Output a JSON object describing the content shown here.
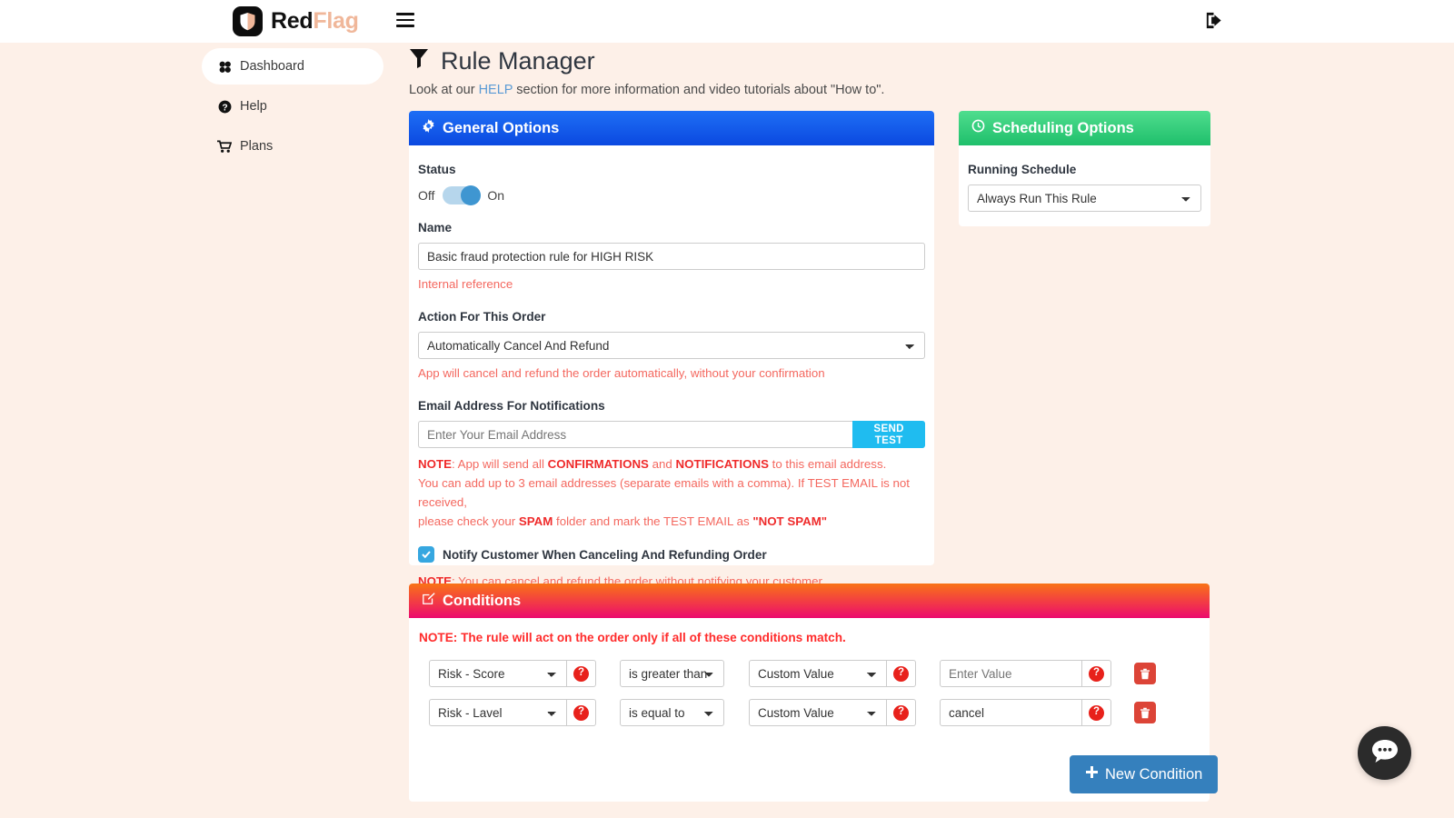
{
  "topbar": {
    "brand_red": "Red",
    "brand_flag": "Flag",
    "menu_icon": "hamburger-menu-icon",
    "logout_icon": "sign-out-icon"
  },
  "sidebar": {
    "items": [
      {
        "label": "Dashboard",
        "icon": "dashboard-icon",
        "active": true
      },
      {
        "label": "Help",
        "icon": "question-circle-icon",
        "active": false
      },
      {
        "label": "Plans",
        "icon": "shopping-cart-icon",
        "active": false
      }
    ]
  },
  "page": {
    "title": "Rule Manager",
    "title_icon": "filter-icon",
    "sub_before": "Look at our ",
    "sub_link": "HELP",
    "sub_after": " section for more information and video tutorials about \"How to\"."
  },
  "general": {
    "header": "General Options",
    "header_icon": "gear-icon",
    "status_label": "Status",
    "toggle_off_label": "Off",
    "toggle_on_label": "On",
    "toggle_state": "on",
    "name_label": "Name",
    "name_value": "Basic fraud protection rule for HIGH RISK",
    "name_hint": "Internal reference",
    "action_label": "Action For This Order",
    "action_value": "Automatically Cancel And Refund",
    "action_hint": "App will cancel and refund the order automatically, without your confirmation",
    "email_label": "Email Address For Notifications",
    "email_placeholder": "Enter Your Email Address",
    "email_value": "",
    "send_test_label": "SEND TEST",
    "note_line1_a": "NOTE",
    "note_line1_b": ": App will send all ",
    "note_line1_c": "CONFIRMATIONS",
    "note_line1_d": " and ",
    "note_line1_e": "NOTIFICATIONS",
    "note_line1_f": " to this email address.",
    "note_line2": "You can add up to 3 email addresses (separate emails with a comma). If TEST EMAIL is not received,",
    "note_line3_a": "please check your ",
    "note_line3_b": "SPAM",
    "note_line3_c": " folder and mark the TEST EMAIL as ",
    "note_line3_d": "\"NOT SPAM\"",
    "notify_checkbox_label": "Notify Customer When Canceling And Refunding Order",
    "notify_checked": true,
    "notify_note_a": "NOTE",
    "notify_note_b": ": You can cancel and refund the order without notifying your customer."
  },
  "scheduling": {
    "header": "Scheduling Options",
    "header_icon": "clock-icon",
    "schedule_label": "Running Schedule",
    "schedule_value": "Always Run This Rule"
  },
  "conditions": {
    "header": "Conditions",
    "header_icon": "edit-square-icon",
    "note": "NOTE: The rule will act on the order only if all of these conditions match.",
    "new_condition_label": "New Condition",
    "rows": [
      {
        "field": "Risk - Score",
        "operator": "is greater than",
        "value_type": "Custom Value",
        "value": "",
        "value_placeholder": "Enter Value"
      },
      {
        "field": "Risk - Lavel",
        "operator": "is equal to",
        "value_type": "Custom Value",
        "value": "cancel",
        "value_placeholder": "Enter Value"
      }
    ]
  },
  "chat": {
    "icon": "chat-bubble-icon"
  },
  "colors": {
    "page_bg": "#fdf0e8",
    "blue_header": "#0b49e0",
    "green_header": "#1fbf6b",
    "pink_header": "#ec0a6e",
    "red_text": "#f4685f",
    "cyan_button": "#1fbcf0",
    "blue_button": "#3580bd"
  }
}
